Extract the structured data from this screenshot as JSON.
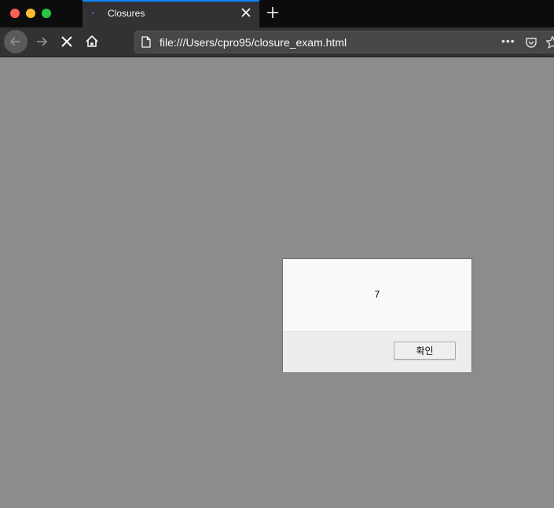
{
  "tab": {
    "title": "Closures"
  },
  "urlbar": {
    "url": "file:///Users/cpro95/closure_exam.html"
  },
  "dialog": {
    "message": "7",
    "ok_label": "확인"
  },
  "colors": {
    "tabbar_bg": "#0c0c0d",
    "toolbar_bg": "#323234",
    "tab_accent": "#0a84ff",
    "page_overlay": "#8c8c8c"
  },
  "icons": {
    "window_controls": [
      "close-dot",
      "minimize-dot",
      "zoom-dot"
    ],
    "toolbar": [
      "back-arrow-icon",
      "forward-arrow-icon",
      "stop-icon",
      "home-icon"
    ],
    "url_actions": [
      "page-icon",
      "more-icon",
      "pocket-icon",
      "star-icon"
    ]
  }
}
